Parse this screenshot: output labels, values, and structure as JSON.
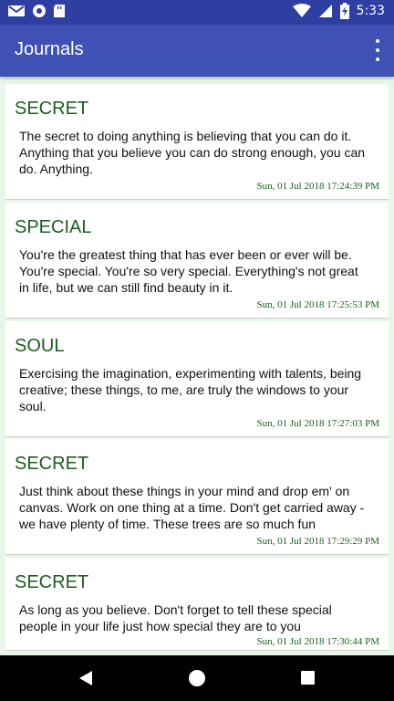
{
  "status": {
    "time": "5:33"
  },
  "appbar": {
    "title": "Journals"
  },
  "entries": [
    {
      "title": "SECRET",
      "body": "The secret to doing anything is believing that you can do it. Anything that you believe you can do strong enough, you can do. Anything.",
      "date": "Sun, 01 Jul 2018 17:24:39 PM"
    },
    {
      "title": "SPECIAL",
      "body": "You're the greatest thing that has ever been or ever will be. You're special. You're so very special. Everything's not great in life, but we can still find beauty in it.",
      "date": "Sun, 01 Jul 2018 17:25:53 PM"
    },
    {
      "title": "SOUL",
      "body": "Exercising the imagination, experimenting with talents, being creative; these things, to me, are truly the windows to your soul.",
      "date": "Sun, 01 Jul 2018 17:27:03 PM"
    },
    {
      "title": "SECRET",
      "body": "Just think about these things in your mind and drop em' on canvas. Work on one thing at a time. Don't get carried away - we have plenty of time. These trees are so much fun",
      "date": "Sun, 01 Jul 2018 17:29:29 PM"
    },
    {
      "title": "SECRET",
      "body": "As long as you believe. Don't forget to tell these special people in your life just how special they are to you",
      "date": "Sun, 01 Jul 2018 17:30:44 PM"
    }
  ]
}
